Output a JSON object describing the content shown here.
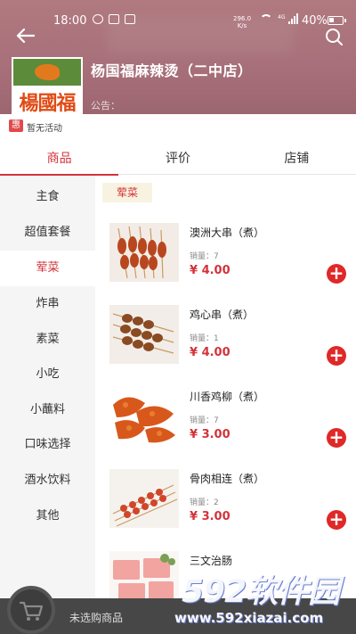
{
  "status": {
    "time": "18:00",
    "net_speed_value": "296.0",
    "net_speed_unit": "K/s",
    "network": "4G",
    "battery": "40%"
  },
  "shop": {
    "name": "杨国福麻辣烫（二中店）",
    "logo_text": "楊國福",
    "notice": "公告："
  },
  "promo": {
    "badge": "惠",
    "text": "暂无活动"
  },
  "tabs": [
    {
      "label": "商品",
      "active": true
    },
    {
      "label": "评价",
      "active": false
    },
    {
      "label": "店铺",
      "active": false
    }
  ],
  "categories": [
    {
      "label": "主食",
      "active": false
    },
    {
      "label": "超值套餐",
      "active": false
    },
    {
      "label": "荤菜",
      "active": true
    },
    {
      "label": "炸串",
      "active": false
    },
    {
      "label": "素菜",
      "active": false
    },
    {
      "label": "小吃",
      "active": false
    },
    {
      "label": "小蘸料",
      "active": false
    },
    {
      "label": "口味选择",
      "active": false
    },
    {
      "label": "酒水饮料",
      "active": false
    },
    {
      "label": "其他",
      "active": false
    }
  ],
  "section_title": "荤菜",
  "items": [
    {
      "name": "澳洲大串（煮）",
      "sales": "销量：7",
      "price": "¥ 4.00"
    },
    {
      "name": "鸡心串（煮）",
      "sales": "销量：1",
      "price": "¥ 4.00"
    },
    {
      "name": "川香鸡柳（煮）",
      "sales": "销量：7",
      "price": "¥ 3.00"
    },
    {
      "name": "骨肉相连（煮）",
      "sales": "销量：2",
      "price": "¥ 3.00"
    },
    {
      "name": "三文治肠",
      "sales": "",
      "price": ""
    }
  ],
  "cart": {
    "text": "未选购商品"
  },
  "watermark": {
    "big": "592软件园",
    "small": "www.592xiazai.com"
  },
  "colors": {
    "accent": "#d3333a",
    "header": "#a8707a",
    "add_button": "#e02828"
  }
}
